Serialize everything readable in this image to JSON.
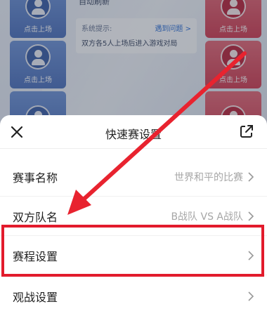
{
  "lobby": {
    "top_partial_text": "自动刷新",
    "seat_label": "点击上场",
    "notice_title": "系统提示:",
    "notice_link": "遇到问题 >",
    "notice_body": "双方各5人上场后进入游戏对局"
  },
  "sheet": {
    "title": "快速赛设置",
    "close_icon": "close-icon",
    "share_icon": "share-icon",
    "rows": [
      {
        "label": "赛事名称",
        "value": "世界和平的比赛"
      },
      {
        "label": "双方队名",
        "value": "B战队 VS A战队"
      },
      {
        "label": "赛程设置",
        "value": ""
      },
      {
        "label": "观战设置",
        "value": ""
      }
    ]
  },
  "annotation": {
    "arrow_color": "#e8232f",
    "highlight_color": "#e21b2c"
  }
}
